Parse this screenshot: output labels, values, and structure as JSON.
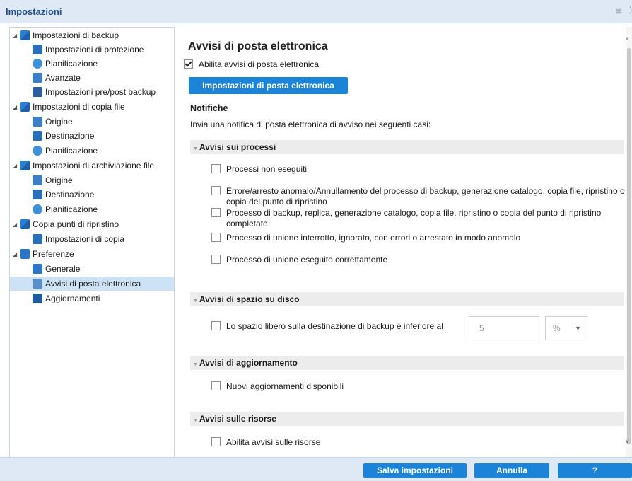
{
  "window": {
    "title": "Impostazioni"
  },
  "tree": {
    "backup": {
      "label": "Impostazioni di backup",
      "items": [
        "Impostazioni di protezione",
        "Pianificazione",
        "Avanzate",
        "Impostazioni pre/post backup"
      ]
    },
    "filecopy": {
      "label": "Impostazioni di copia file",
      "items": [
        "Origine",
        "Destinazione",
        "Pianificazione"
      ]
    },
    "archive": {
      "label": "Impostazioni di archiviazione file",
      "items": [
        "Origine",
        "Destinazione",
        "Pianificazione"
      ]
    },
    "restorepoints": {
      "label": "Copia punti di ripristino",
      "items": [
        "Impostazioni di copia"
      ]
    },
    "prefs": {
      "label": "Preferenze",
      "items": [
        "Generale",
        "Avvisi di posta elettronica",
        "Aggiornamenti"
      ],
      "selected": "Avvisi di posta elettronica"
    }
  },
  "content": {
    "title": "Avvisi di posta elettronica",
    "enable_label": "Abilita avvisi di posta elettronica",
    "enable_checked": true,
    "email_settings_button": "Impostazioni di posta elettronica",
    "notifications_heading": "Notifiche",
    "notifications_intro": "Invia una notifica di posta elettronica di avviso nei seguenti casi:",
    "job_alerts": {
      "heading": "Avvisi sui processi",
      "items": [
        "Processi non eseguiti",
        "Errore/arresto anomalo/Annullamento del processo di backup, generazione catalogo, copia file, ripristino o copia del punto di ripristino",
        "Processo di backup, replica, generazione catalogo, copia file, ripristino o copia del punto di ripristino completato",
        "Processo di unione interrotto, ignorato, con errori o arrestato in modo anomalo",
        "Processo di unione eseguito correttamente"
      ]
    },
    "disk_alerts": {
      "heading": "Avvisi di spazio su disco",
      "item": "Lo spazio libero sulla destinazione di backup è inferiore al",
      "value": "5",
      "unit": "%"
    },
    "update_alerts": {
      "heading": "Avvisi di aggiornamento",
      "item": "Nuovi aggiornamenti disponibili"
    },
    "resource_alerts": {
      "heading": "Avvisi sulle risorse",
      "item": "Abilita avvisi sulle risorse"
    }
  },
  "footer": {
    "save": "Salva impostazioni",
    "cancel": "Annulla",
    "help": "?"
  },
  "colors": {
    "accent": "#1b84d8",
    "title_bar": "#dfe9f5",
    "selection": "#cde3f5",
    "section_bg": "#ececec"
  }
}
